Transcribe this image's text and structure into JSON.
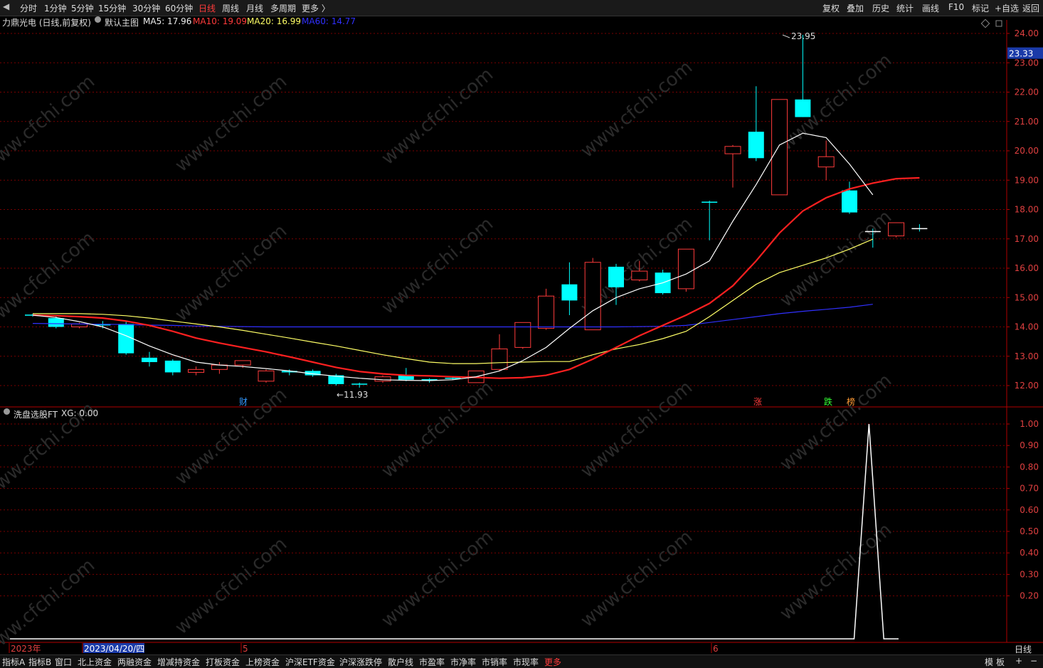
{
  "toolbar": {
    "periods": [
      "分时",
      "1分钟",
      "5分钟",
      "15分钟",
      "30分钟",
      "60分钟",
      "日线",
      "周线",
      "月线",
      "多周期",
      "更多 〉"
    ],
    "active_period": "日线",
    "right_items": [
      "复权",
      "叠加",
      "历史",
      "统计",
      "画线",
      "F10",
      "标记",
      "+自选",
      "返回"
    ]
  },
  "main_title": {
    "stock": "力鼎光电 (日线,前复权)",
    "chart_name": "默认主图",
    "ma5": "MA5: 17.96",
    "ma10": "MA10: 19.09",
    "ma20": "MA20: 16.99",
    "ma60": "MA60: 14.77"
  },
  "indicator_title": {
    "name": "洗盘选股FT",
    "xg": "XG: 0.00"
  },
  "watermark": "www.cfchi.com",
  "axis": {
    "price_ticks": [
      "24.00",
      "23.00",
      "22.00",
      "21.00",
      "20.00",
      "19.00",
      "18.00",
      "17.00",
      "16.00",
      "15.00",
      "14.00",
      "13.00",
      "12.00"
    ],
    "current_price": "23.33",
    "ind_ticks": [
      "1.00",
      "0.90",
      "0.80",
      "0.70",
      "0.60",
      "0.50",
      "0.40",
      "0.30",
      "0.20"
    ],
    "period_label": "日线",
    "date_labels": [
      "2023年",
      "2023/04/20/四",
      "5",
      "6"
    ]
  },
  "markers": {
    "high": "23.95",
    "low": "←11.93",
    "events": [
      "财",
      "涨",
      "跌",
      "榜"
    ]
  },
  "bottom_tabs": [
    "指标A",
    "指标B",
    "窗口",
    "北上资金",
    "两融资金",
    "增减持资金",
    "打板资金",
    "上榜资金",
    "沪深ETF资金",
    "沪深涨跌停",
    "散户线",
    "市盈率",
    "市净率",
    "市销率",
    "市现率",
    "更多"
  ],
  "bottom_right": [
    "模",
    "板",
    "+",
    "−"
  ],
  "colors": {
    "up": "#ff3b3b",
    "down": "#00ffff",
    "ma5": "#ffffff",
    "ma10": "#ff2020",
    "ma20": "#ffff66",
    "ma60": "#3030ff",
    "grid": "#7a0000",
    "axis": "#b00000"
  },
  "chart_data": {
    "type": "candlestick",
    "ylim": [
      11.8,
      24.2
    ],
    "candles": [
      {
        "o": 14.4,
        "c": 14.4,
        "h": 14.45,
        "l": 14.35
      },
      {
        "o": 14.3,
        "c": 14.0,
        "h": 14.35,
        "l": 13.95
      },
      {
        "o": 14.0,
        "c": 14.1,
        "h": 14.15,
        "l": 13.95
      },
      {
        "o": 14.1,
        "c": 14.05,
        "h": 14.2,
        "l": 13.95
      },
      {
        "o": 14.1,
        "c": 13.1,
        "h": 14.2,
        "l": 13.05
      },
      {
        "o": 12.95,
        "c": 12.8,
        "h": 13.15,
        "l": 12.65
      },
      {
        "o": 12.85,
        "c": 12.45,
        "h": 12.9,
        "l": 12.35
      },
      {
        "o": 12.45,
        "c": 12.55,
        "h": 12.65,
        "l": 12.35
      },
      {
        "o": 12.55,
        "c": 12.7,
        "h": 12.8,
        "l": 12.4
      },
      {
        "o": 12.7,
        "c": 12.85,
        "h": 12.85,
        "l": 12.6
      },
      {
        "o": 12.15,
        "c": 12.5,
        "h": 12.55,
        "l": 12.1
      },
      {
        "o": 12.5,
        "c": 12.45,
        "h": 12.55,
        "l": 12.35
      },
      {
        "o": 12.5,
        "c": 12.35,
        "h": 12.55,
        "l": 12.3
      },
      {
        "o": 12.35,
        "c": 12.05,
        "h": 12.4,
        "l": 12.0
      },
      {
        "o": 12.05,
        "c": 12.05,
        "h": 12.1,
        "l": 11.93
      },
      {
        "o": 12.15,
        "c": 12.3,
        "h": 12.35,
        "l": 12.1
      },
      {
        "o": 12.35,
        "c": 12.2,
        "h": 12.6,
        "l": 12.15
      },
      {
        "o": 12.2,
        "c": 12.2,
        "h": 12.25,
        "l": 12.1
      },
      {
        "o": 12.25,
        "c": 12.25,
        "h": 12.3,
        "l": 12.2
      },
      {
        "o": 12.1,
        "c": 12.5,
        "h": 12.5,
        "l": 12.1
      },
      {
        "o": 12.55,
        "c": 13.25,
        "h": 13.75,
        "l": 12.5
      },
      {
        "o": 13.3,
        "c": 14.15,
        "h": 14.15,
        "l": 13.25
      },
      {
        "o": 13.95,
        "c": 15.05,
        "h": 15.3,
        "l": 13.9
      },
      {
        "o": 15.45,
        "c": 14.9,
        "h": 16.2,
        "l": 14.4
      },
      {
        "o": 13.9,
        "c": 16.2,
        "h": 16.35,
        "l": 13.9
      },
      {
        "o": 16.05,
        "c": 15.35,
        "h": 16.15,
        "l": 14.75
      },
      {
        "o": 15.6,
        "c": 15.9,
        "h": 16.25,
        "l": 15.55
      },
      {
        "o": 15.85,
        "c": 15.15,
        "h": 15.95,
        "l": 15.1
      },
      {
        "o": 15.3,
        "c": 16.65,
        "h": 16.65,
        "l": 15.2
      },
      {
        "o": 18.25,
        "c": 18.25,
        "h": 18.3,
        "l": 16.95
      },
      {
        "o": 19.9,
        "c": 20.15,
        "h": 20.2,
        "l": 18.75
      },
      {
        "o": 20.65,
        "c": 19.75,
        "h": 22.2,
        "l": 19.65
      },
      {
        "o": 18.5,
        "c": 21.75,
        "h": 21.75,
        "l": 18.5
      },
      {
        "o": 21.75,
        "c": 21.15,
        "h": 23.95,
        "l": 21.15
      },
      {
        "o": 19.45,
        "c": 19.8,
        "h": 20.35,
        "l": 19.0
      },
      {
        "o": 18.65,
        "c": 17.9,
        "h": 18.95,
        "l": 17.85
      },
      {
        "o": 17.25,
        "c": 17.25,
        "h": 17.35,
        "l": 16.7
      },
      {
        "o": 17.1,
        "c": 17.55,
        "h": 17.55,
        "l": 17.05
      },
      {
        "o": 17.35,
        "c": 17.35,
        "h": 17.5,
        "l": 17.25
      }
    ],
    "ma5": [
      14.4,
      14.32,
      14.18,
      14.0,
      13.7,
      13.35,
      13.05,
      12.8,
      12.7,
      12.65,
      12.58,
      12.5,
      12.4,
      12.32,
      12.25,
      12.2,
      12.18,
      12.17,
      12.2,
      12.3,
      12.5,
      12.85,
      13.3,
      13.95,
      14.55,
      15.0,
      15.3,
      15.5,
      15.8,
      16.25,
      17.6,
      18.85,
      20.2,
      20.6,
      20.45,
      19.55,
      18.5
    ],
    "ma10": [
      14.4,
      14.38,
      14.35,
      14.3,
      14.2,
      14.05,
      13.85,
      13.62,
      13.45,
      13.3,
      13.15,
      12.98,
      12.8,
      12.62,
      12.48,
      12.4,
      12.35,
      12.33,
      12.3,
      12.28,
      12.25,
      12.27,
      12.35,
      12.55,
      12.9,
      13.3,
      13.7,
      14.05,
      14.4,
      14.8,
      15.4,
      16.25,
      17.2,
      17.95,
      18.4,
      18.7,
      18.9,
      19.05,
      19.08
    ],
    "ma20": [
      14.45,
      14.45,
      14.45,
      14.43,
      14.38,
      14.3,
      14.2,
      14.1,
      14.0,
      13.88,
      13.75,
      13.62,
      13.48,
      13.35,
      13.2,
      13.05,
      12.92,
      12.8,
      12.75,
      12.75,
      12.78,
      12.8,
      12.82,
      12.82,
      13.05,
      13.25,
      13.4,
      13.6,
      13.85,
      14.35,
      14.9,
      15.45,
      15.85,
      16.1,
      16.35,
      16.65,
      16.99
    ],
    "ma60": [
      14.12,
      14.11,
      14.1,
      14.09,
      14.08,
      14.06,
      14.05,
      14.03,
      14.02,
      14.01,
      14.0,
      14.0,
      14.0,
      14.0,
      14.0,
      14.0,
      14.0,
      14.0,
      14.0,
      14.0,
      14.0,
      14.0,
      14.0,
      14.0,
      14.0,
      14.0,
      14.01,
      14.02,
      14.05,
      14.15,
      14.25,
      14.35,
      14.45,
      14.53,
      14.6,
      14.67,
      14.77
    ],
    "xg": [
      0,
      0,
      0,
      0,
      0,
      0,
      0,
      0,
      0,
      0,
      0,
      0,
      0,
      0,
      0,
      0,
      0,
      0,
      0,
      0,
      0,
      0,
      0,
      0,
      0,
      0,
      0,
      0,
      0,
      0,
      0,
      0,
      0,
      0,
      0,
      0,
      0,
      0,
      0,
      0,
      0,
      0,
      0,
      0,
      0,
      0,
      0,
      0,
      0,
      0,
      0,
      0,
      0,
      0,
      0,
      0,
      0,
      0,
      1,
      0,
      0
    ],
    "ind_ylim": [
      0,
      1.0
    ]
  }
}
